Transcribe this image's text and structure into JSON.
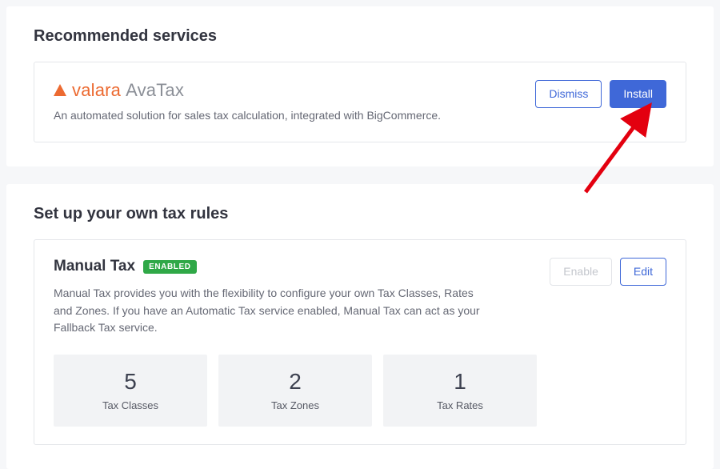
{
  "recommended": {
    "title": "Recommended services",
    "service": {
      "brand_first": "valara",
      "brand_second": "AvaTax",
      "description": "An automated solution for sales tax calculation, integrated with BigCommerce.",
      "dismiss_label": "Dismiss",
      "install_label": "Install"
    }
  },
  "own_rules": {
    "title": "Set up your own tax rules",
    "manual": {
      "name": "Manual Tax",
      "badge": "ENABLED",
      "description": "Manual Tax provides you with the flexibility to configure your own Tax Classes, Rates and Zones. If you have an Automatic Tax service enabled, Manual Tax can act as your Fallback Tax service.",
      "enable_label": "Enable",
      "edit_label": "Edit",
      "stats": [
        {
          "value": "5",
          "label": "Tax Classes"
        },
        {
          "value": "2",
          "label": "Tax Zones"
        },
        {
          "value": "1",
          "label": "Tax Rates"
        }
      ]
    }
  }
}
